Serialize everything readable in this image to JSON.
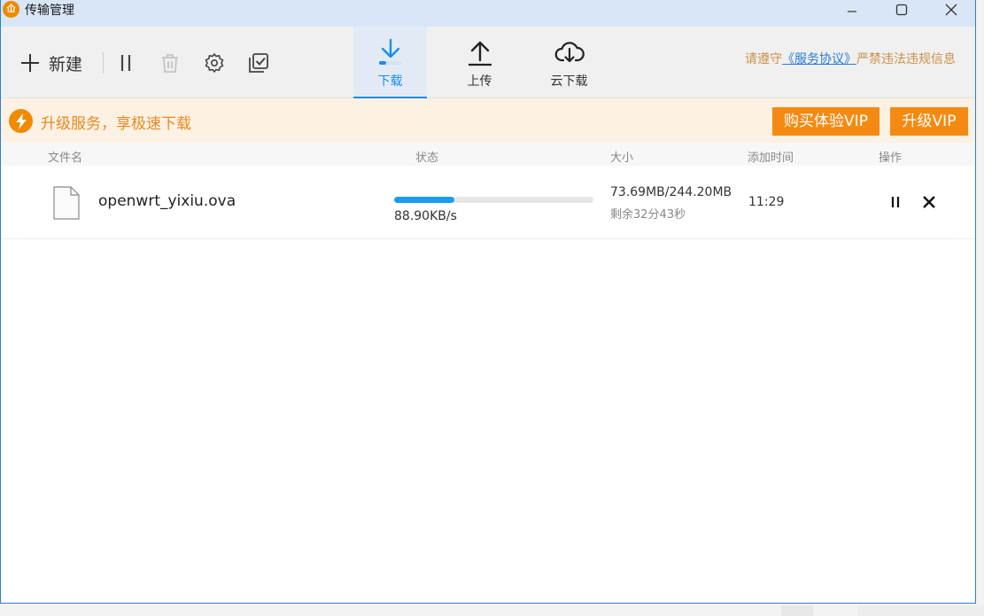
{
  "window": {
    "title": "传输管理",
    "logo_text": "仚"
  },
  "toolbar": {
    "new_label": "新建",
    "tabs": [
      {
        "label": "下载",
        "active": true
      },
      {
        "label": "上传",
        "active": false
      },
      {
        "label": "云下载",
        "active": false
      }
    ],
    "notice_prefix": "请遵守",
    "notice_link": "《服务协议》",
    "notice_suffix": "严禁违法违规信息"
  },
  "promo": {
    "text": "升级服务，享极速下载",
    "buy_vip": "购买体验VIP",
    "upgrade_vip": "升级VIP"
  },
  "columns": {
    "name": "文件名",
    "status": "状态",
    "size": "大小",
    "added": "添加时间",
    "action": "操作"
  },
  "rows": [
    {
      "filename": "openwrt_yixiu.ova",
      "progress": 0.302,
      "speed": "88.90KB/s",
      "size": "73.69MB/244.20MB",
      "remaining": "剩余32分43秒",
      "time": "11:29"
    }
  ],
  "colors": {
    "accent": "#1a8cf2",
    "vip": "#f58a12",
    "promo_bg": "#fdf1e4"
  }
}
